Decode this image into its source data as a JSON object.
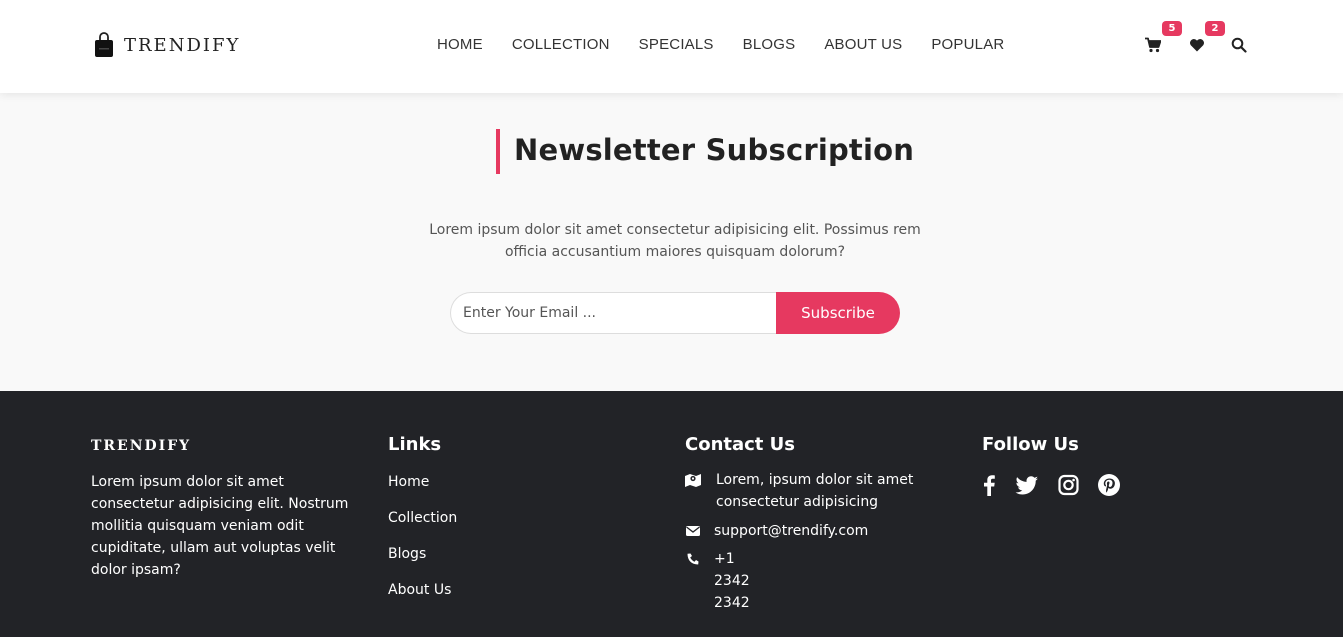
{
  "header": {
    "brand": "TRENDIFY",
    "nav": [
      "HOME",
      "COLLECTION",
      "SPECIALS",
      "BLOGS",
      "ABOUT US",
      "POPULAR"
    ],
    "cart_count": "5",
    "wishlist_count": "2",
    "icons": [
      "bag-logo-icon",
      "cart-icon",
      "heart-icon",
      "search-icon"
    ]
  },
  "newsletter": {
    "title": "Newsletter Subscription",
    "description": "Lorem ipsum dolor sit amet consectetur adipisicing elit. Possimus rem officia accusantium maiores quisquam dolorum?",
    "email_placeholder": "Enter Your Email ...",
    "subscribe_label": "Subscribe"
  },
  "footer": {
    "brand": "TRENDIFY",
    "about": "Lorem ipsum dolor sit amet consectetur adipisicing elit. Nostrum mollitia quisquam veniam odit cupiditate, ullam aut voluptas velit dolor ipsam?",
    "links_heading": "Links",
    "links": [
      "Home",
      "Collection",
      "Blogs",
      "About Us"
    ],
    "contact_heading": "Contact Us",
    "contact": {
      "address": "Lorem, ipsum dolor sit amet consectetur adipisicing",
      "email": "support@trendify.com",
      "phone": "+1 2342 2342"
    },
    "follow_heading": "Follow Us",
    "social": [
      "facebook-icon",
      "twitter-icon",
      "instagram-icon",
      "pinterest-icon"
    ]
  },
  "colors": {
    "accent": "#e63960",
    "footer_bg": "#222327",
    "section_bg": "#f9f9f9"
  }
}
